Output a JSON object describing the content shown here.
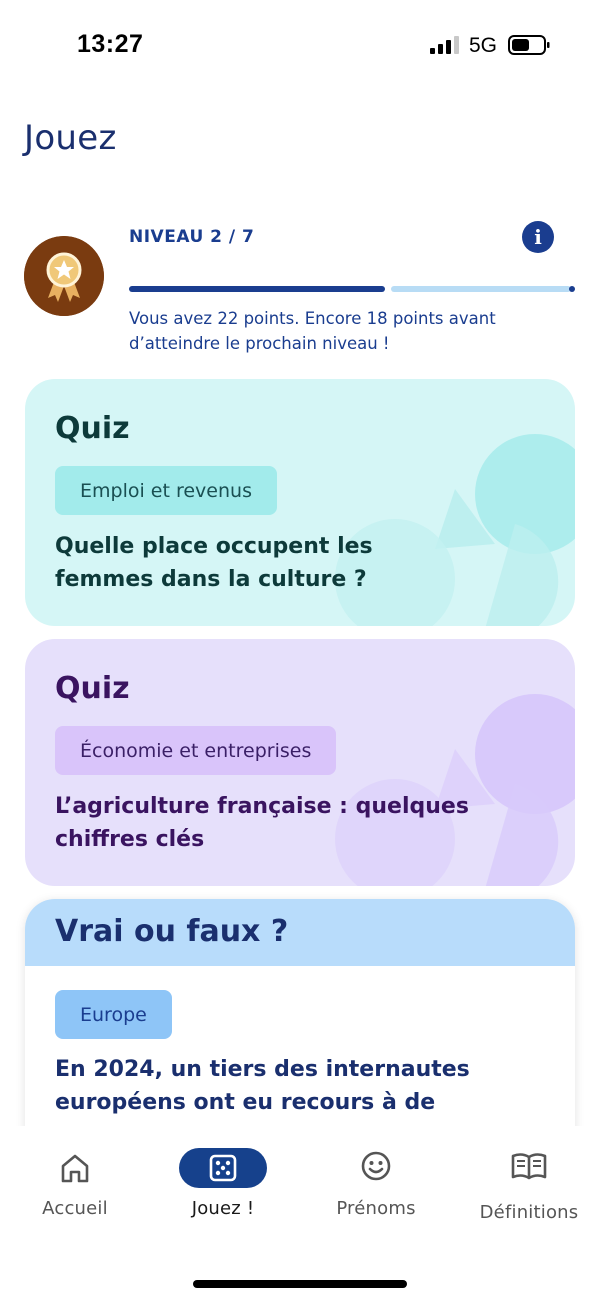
{
  "status": {
    "time": "13:27",
    "network": "5G"
  },
  "page": {
    "title": "Jouez"
  },
  "level": {
    "label": "NIVEAU 2 / 7",
    "progress": 0.58,
    "message": "Vous avez 22 points. Encore 18 points avant d’atteindre le prochain niveau !"
  },
  "cards": [
    {
      "type": "Quiz",
      "tag": "Emploi et revenus",
      "question": "Quelle place occupent les femmes dans la culture ?"
    },
    {
      "type": "Quiz",
      "tag": "Économie et entreprises",
      "question": "L’agriculture française : quelques chiffres clés"
    },
    {
      "type": "Vrai ou faux ?",
      "tag": "Europe",
      "question": "En 2024, un tiers des internautes européens ont eu recours à de"
    }
  ],
  "tabs": [
    {
      "label": "Accueil",
      "icon": "home-icon"
    },
    {
      "label": "Jouez !",
      "icon": "dice-icon",
      "active": true
    },
    {
      "label": "Prénoms",
      "icon": "smiley-icon"
    },
    {
      "label": "Définitions",
      "icon": "book-icon"
    }
  ],
  "colors": {
    "primary": "#1a3d8f",
    "quiz_teal": "#d5f6f6",
    "quiz_purple": "#e6e0fb",
    "vf_blue": "#b8dcfb",
    "medal_brown": "#7a3b10"
  }
}
